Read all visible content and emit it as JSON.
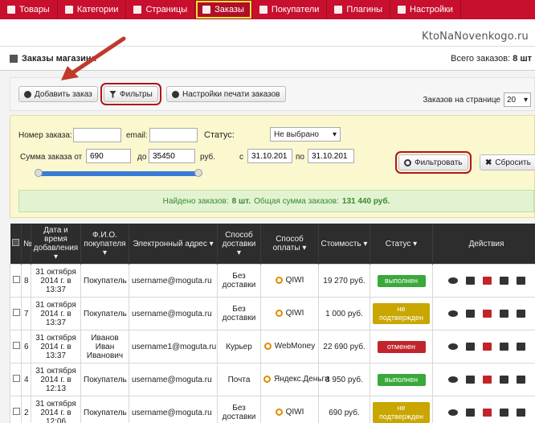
{
  "nav": [
    {
      "label": "Товары",
      "icon": "products-icon"
    },
    {
      "label": "Категории",
      "icon": "categories-icon"
    },
    {
      "label": "Страницы",
      "icon": "pages-icon"
    },
    {
      "label": "Заказы",
      "icon": "orders-icon",
      "active": true
    },
    {
      "label": "Покупатели",
      "icon": "customers-icon"
    },
    {
      "label": "Плагины",
      "icon": "plugins-icon"
    },
    {
      "label": "Настройки",
      "icon": "settings-icon"
    }
  ],
  "watermark": "KtoNaNovenkogo.ru",
  "page": {
    "title": "Заказы магазина",
    "total_label": "Всего заказов:",
    "total_value": "8 шт"
  },
  "toolbar": {
    "add_label": "Добавить заказ",
    "filters_label": "Фильтры",
    "print_label": "Настройки печати заказов",
    "per_page_label": "Заказов на странице",
    "per_page_value": "20"
  },
  "filters": {
    "order_no_label": "Номер заказа:",
    "email_label": "email:",
    "status_label": "Статус:",
    "status_value": "Не выбрано",
    "sum_label": "Сумма заказа от",
    "sum_from": "690",
    "sum_to_label": "до",
    "sum_to": "35450",
    "currency": "руб.",
    "date_from_label": "с",
    "date_from": "31.10.201",
    "date_to_label": "по",
    "date_to": "31.10.201",
    "filter_btn": "Фильтровать",
    "reset_btn": "Сбросить",
    "found_prefix": "Найдено заказов:",
    "found_count": "8 шт.",
    "found_mid": "Общая сумма заказов:",
    "found_sum": "131 440 руб."
  },
  "table": {
    "headers": [
      "№",
      "Дата и время добавления",
      "Ф.И.О. покупателя",
      "Электронный адрес",
      "Способ доставки",
      "Способ оплаты",
      "Стоимость",
      "Статус",
      "Действия"
    ],
    "rows": [
      {
        "no": "8",
        "date": "31 октября 2014 г. в 13:37",
        "name": "Покупатель",
        "email": "username@moguta.ru",
        "delivery": "Без доставки",
        "payment": "QIWI",
        "cost": "19 270 руб.",
        "status": "выполнен",
        "status_color": "#3aa83a"
      },
      {
        "no": "7",
        "date": "31 октября 2014 г. в 13:37",
        "name": "Покупатель",
        "email": "username@moguta.ru",
        "delivery": "Без доставки",
        "payment": "QIWI",
        "cost": "1 000 руб.",
        "status": "не подтвержден",
        "status_color": "#c9a600"
      },
      {
        "no": "6",
        "date": "31 октября 2014 г. в 13:37",
        "name": "Иванов Иван Иванович",
        "email": "username1@moguta.ru",
        "delivery": "Курьер",
        "payment": "WebMoney",
        "cost": "22 690 руб.",
        "status": "отменен",
        "status_color": "#c0252b"
      },
      {
        "no": "4",
        "date": "31 октября 2014 г. в 12:13",
        "name": "Покупатель",
        "email": "username@moguta.ru",
        "delivery": "Почта",
        "payment": "Яндекс.Деньги",
        "cost": "3 950 руб.",
        "status": "выполнен",
        "status_color": "#3aa83a"
      },
      {
        "no": "2",
        "date": "31 октября 2014 г. в 12:06",
        "name": "Покупатель",
        "email": "username@moguta.ru",
        "delivery": "Без доставки",
        "payment": "QIWI",
        "cost": "690 руб.",
        "status": "не подтвержден",
        "status_color": "#c9a600"
      }
    ]
  }
}
